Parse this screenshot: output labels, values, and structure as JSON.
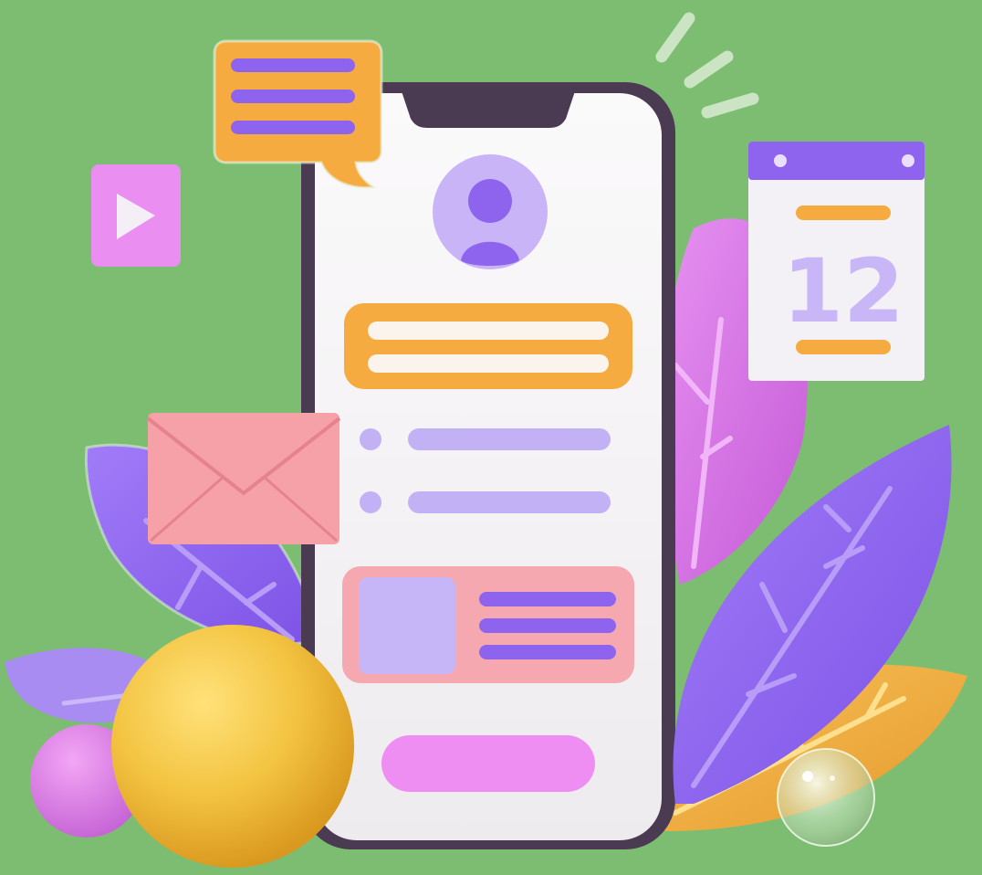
{
  "calendar": {
    "day": "12"
  },
  "colors": {
    "background": "#7cbd72",
    "phone_frame": "#4a3a52",
    "phone_screen": "#f6f4f5",
    "purple": "#8e63ee",
    "lavender": "#c8b6f7",
    "orange": "#f5ab3f",
    "pink": "#f6a8b0",
    "magenta": "#ee8ef2",
    "yellow_ball": "#f2c443"
  },
  "icons": {
    "play": "play-icon",
    "chat": "chat-bubble-icon",
    "mail": "envelope-icon",
    "avatar": "user-avatar-icon",
    "calendar": "calendar-icon"
  }
}
